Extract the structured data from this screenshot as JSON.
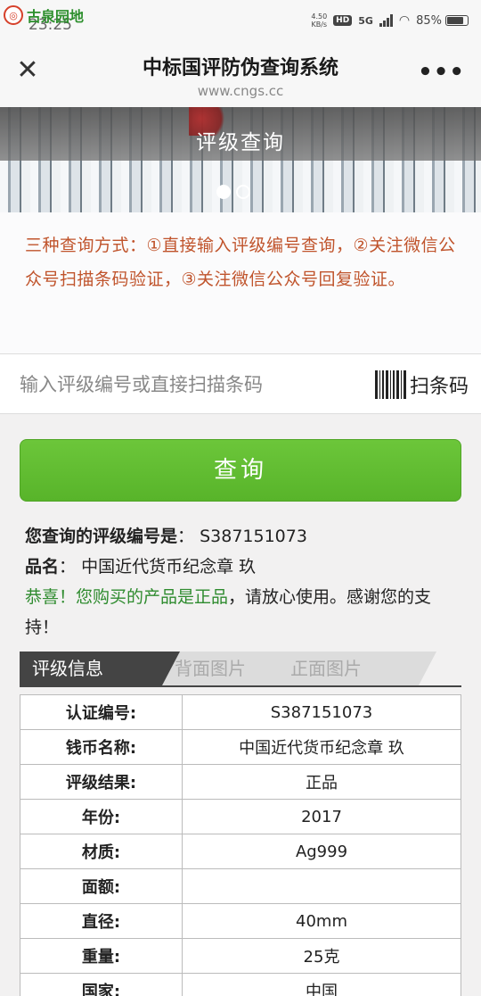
{
  "status_bar": {
    "watermark": "古泉园地",
    "time": "23:25",
    "net_speed": "4.50",
    "net_unit": "KB/s",
    "hd": "HD",
    "network": "5G",
    "battery": "85%",
    "battery_level": 0.85
  },
  "nav": {
    "title": "中标国评防伪查询系统",
    "subtitle": "www.cngs.cc"
  },
  "banner": {
    "title": "评级查询",
    "slides": 2,
    "active_slide": 0
  },
  "notice": {
    "text": "三种查询方式：①直接输入评级编号查询，②关注微信公众号扫描条码验证，③关注微信公众号回复验证。"
  },
  "search": {
    "placeholder": "输入评级编号或直接扫描条码",
    "value": "",
    "scan_label": "扫条码"
  },
  "query_button": "查询",
  "result": {
    "code_label": "您查询的评级编号是",
    "code_sep": "：",
    "code_value": "S387151073",
    "name_label": "品名",
    "name_sep": "：",
    "name_value": "中国近代货币纪念章 玖",
    "congrats": "恭喜！您购买的产品是正品",
    "congrats_rest": "，请放心使用。感谢您的支持！"
  },
  "tabs": [
    {
      "label": "评级信息",
      "active": true
    },
    {
      "label": "背面图片",
      "active": false
    },
    {
      "label": "正面图片",
      "active": false
    }
  ],
  "table": [
    {
      "key": "认证编号:",
      "value": "S387151073"
    },
    {
      "key": "钱币名称:",
      "value": "中国近代货币纪念章 玖"
    },
    {
      "key": "评级结果:",
      "value": "正品"
    },
    {
      "key": "年份:",
      "value": "2017"
    },
    {
      "key": "材质:",
      "value": "Ag999"
    },
    {
      "key": "面额:",
      "value": ""
    },
    {
      "key": "直径:",
      "value": "40mm"
    },
    {
      "key": "重量:",
      "value": "25克"
    },
    {
      "key": "国家:",
      "value": "中国"
    }
  ],
  "colors": {
    "accent_green": "#5cb82e",
    "notice_orange": "#c0542c",
    "success_green": "#2e8b2e"
  }
}
